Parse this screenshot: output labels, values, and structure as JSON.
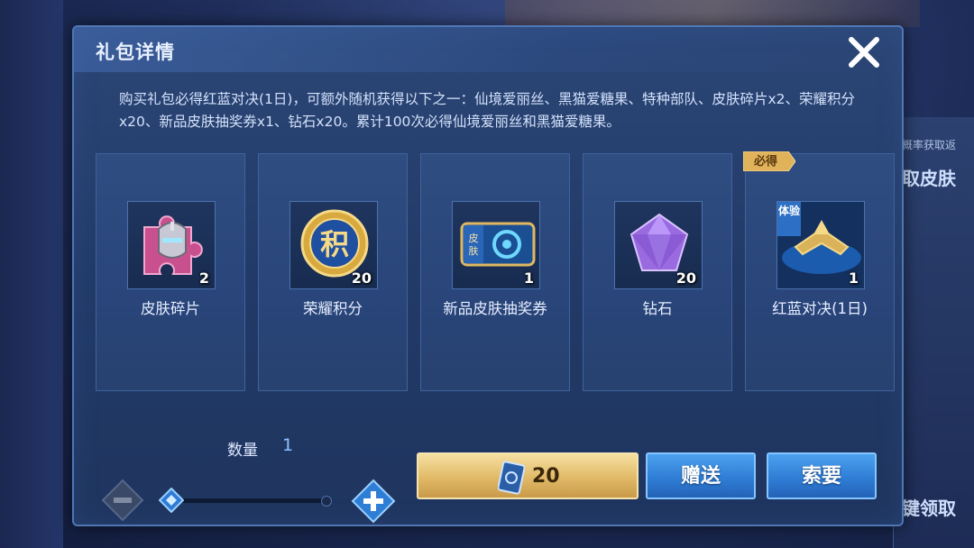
{
  "dialog": {
    "title": "礼包详情",
    "description": "购买礼包必得红蓝对决(1日)，可额外随机获得以下之一：仙境爱丽丝、黑猫爱糖果、特种部队、皮肤碎片x2、荣耀积分x20、新品皮肤抽奖券x1、钻石x20。累计100次必得仙境爱丽丝和黑猫爱糖果。"
  },
  "items": [
    {
      "name": "皮肤碎片",
      "count": "2",
      "icon": "skin-fragment-icon"
    },
    {
      "name": "荣耀积分",
      "count": "20",
      "icon": "glory-points-icon"
    },
    {
      "name": "新品皮肤抽奖券",
      "count": "1",
      "icon": "skin-lottery-ticket-icon"
    },
    {
      "name": "钻石",
      "count": "20",
      "icon": "diamond-icon"
    },
    {
      "name": "红蓝对决(1日)",
      "count": "1",
      "icon": "red-blue-duel-icon",
      "badge": "必得",
      "trial_tag": "体验"
    }
  ],
  "quantity": {
    "label": "数量",
    "value": "1",
    "slider_fraction": 0
  },
  "actions": {
    "buy_price": "20",
    "gift_label": "赠送",
    "ask_label": "索要"
  },
  "background": {
    "right_text_1": "取皮肤",
    "right_text_2": "键领取",
    "right_text_3": "概率获取返"
  },
  "colors": {
    "gold": "#e3bd6c",
    "blue_button": "#2f7ed6",
    "accent_blue": "#8fc0ff"
  }
}
